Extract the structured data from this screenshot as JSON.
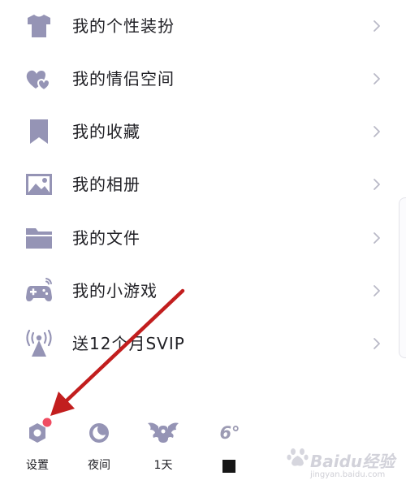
{
  "menu": {
    "items": [
      {
        "label": "我的个性装扮",
        "icon": "tshirt-icon"
      },
      {
        "label": "我的情侣空间",
        "icon": "hearts-icon"
      },
      {
        "label": "我的收藏",
        "icon": "bookmark-icon"
      },
      {
        "label": "我的相册",
        "icon": "photo-icon"
      },
      {
        "label": "我的文件",
        "icon": "folder-icon"
      },
      {
        "label": "我的小游戏",
        "icon": "gamepad-icon"
      },
      {
        "label": "送12个月SVIP",
        "icon": "broadcast-icon"
      }
    ],
    "chevron_icon": "chevron-right-icon"
  },
  "bottom_bar": {
    "settings_label": "设置",
    "night_label": "夜间",
    "checkin_label": "1天",
    "temperature": "6°"
  },
  "watermark": {
    "main": "Baidu经验",
    "sub": "jingyan.baidu.com"
  },
  "colors": {
    "icon": "#9594b5",
    "text": "#1f1f24",
    "chevron": "#b9b9c7",
    "badge": "#f04d62",
    "arrow": "#c21e1e"
  }
}
